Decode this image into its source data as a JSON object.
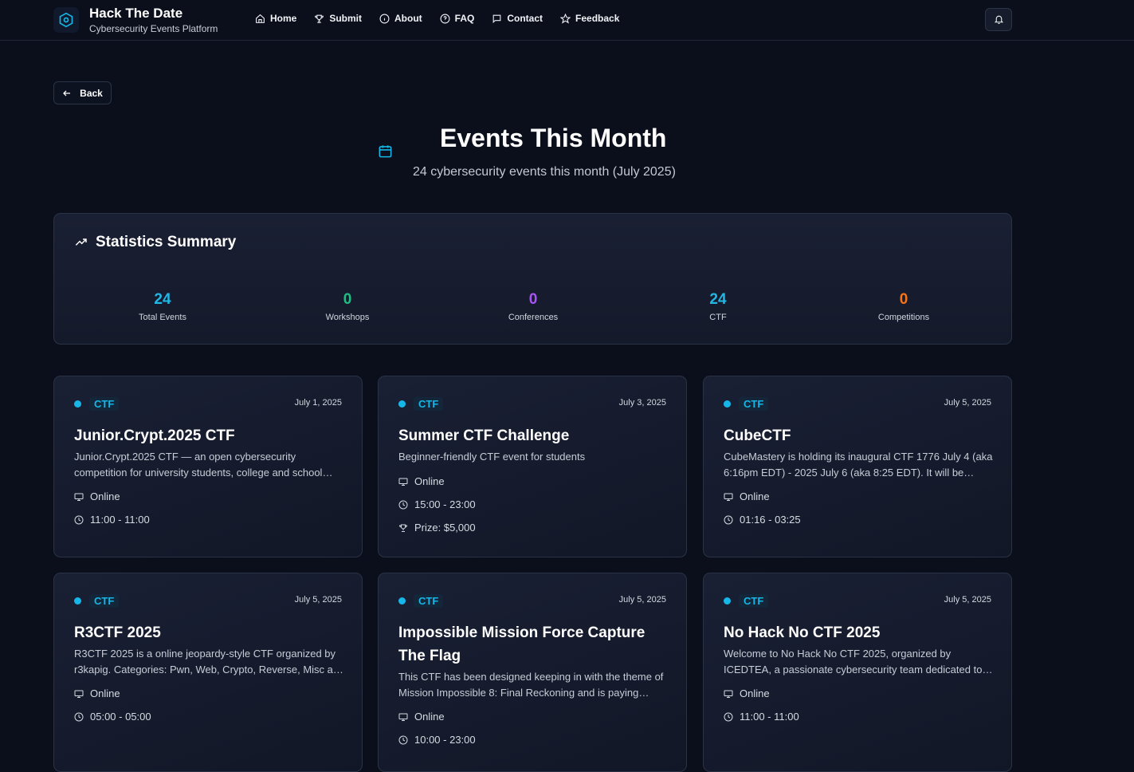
{
  "header": {
    "brand_title": "Hack The Date",
    "brand_subtitle": "Cybersecurity Events Platform",
    "nav": [
      {
        "label": "Home",
        "icon": "home-icon"
      },
      {
        "label": "Submit",
        "icon": "trophy-icon"
      },
      {
        "label": "About",
        "icon": "info-icon"
      },
      {
        "label": "FAQ",
        "icon": "help-circle-icon"
      },
      {
        "label": "Contact",
        "icon": "message-icon"
      },
      {
        "label": "Feedback",
        "icon": "star-icon"
      }
    ],
    "notification_icon": "bell-icon"
  },
  "back_button": {
    "label": "Back",
    "icon": "arrow-left-icon"
  },
  "page": {
    "title": "Events This Month",
    "subtitle": "24 cybersecurity events this month (July 2025)",
    "icon": "calendar-icon"
  },
  "stats": {
    "title": "Statistics Summary",
    "icon": "trending-up-icon",
    "items": [
      {
        "value": "24",
        "label": "Total Events",
        "color": "#22b8e6"
      },
      {
        "value": "0",
        "label": "Workshops",
        "color": "#1fbf83"
      },
      {
        "value": "0",
        "label": "Conferences",
        "color": "#a855f7"
      },
      {
        "value": "24",
        "label": "CTF",
        "color": "#22b8e6"
      },
      {
        "value": "0",
        "label": "Competitions",
        "color": "#f97316"
      }
    ]
  },
  "colors": {
    "accent": "#16b7e8",
    "background": "#0b0f1c",
    "card_border": "#2a3245"
  },
  "events": [
    {
      "type": "CTF",
      "date": "July 1, 2025",
      "title": "Junior.Crypt.2025 CTF",
      "description": "Junior.Crypt.2025 CTF — an open cybersecurity competition for university students, college and school students.",
      "location": "Online",
      "time": "11:00 - 11:00"
    },
    {
      "type": "CTF",
      "date": "July 3, 2025",
      "title": "Summer CTF Challenge",
      "description": "Beginner-friendly CTF event for students",
      "location": "Online",
      "time": "15:00 - 23:00",
      "prize": "Prize: $5,000"
    },
    {
      "type": "CTF",
      "date": "July 5, 2025",
      "title": "CubeCTF",
      "description": "CubeMastery is holding its inaugural CTF 1776 July 4 (aka 6:16pm EDT) - 2025 July 6 (aka 8:25 EDT). It will be online.",
      "location": "Online",
      "time": "01:16 - 03:25"
    },
    {
      "type": "CTF",
      "date": "July 5, 2025",
      "title": "R3CTF 2025",
      "description": "R3CTF 2025 is a online jeopardy-style CTF organized by r3kapig. Categories: Pwn, Web, Crypto, Reverse, Misc and more.",
      "location": "Online",
      "time": "05:00 - 05:00"
    },
    {
      "type": "CTF",
      "date": "July 5, 2025",
      "title": "Impossible Mission Force Capture The Flag",
      "description": "This CTF has been designed keeping in with the theme of Mission Impossible 8: Final Reckoning and is paying tribute to the series.",
      "location": "Online",
      "time": "10:00 - 23:00"
    },
    {
      "type": "CTF",
      "date": "July 5, 2025",
      "title": "No Hack No CTF 2025",
      "description": "Welcome to No Hack No CTF 2025, organized by ICEDTEA, a passionate cybersecurity team dedicated to security.",
      "location": "Online",
      "time": "11:00 - 11:00"
    }
  ]
}
